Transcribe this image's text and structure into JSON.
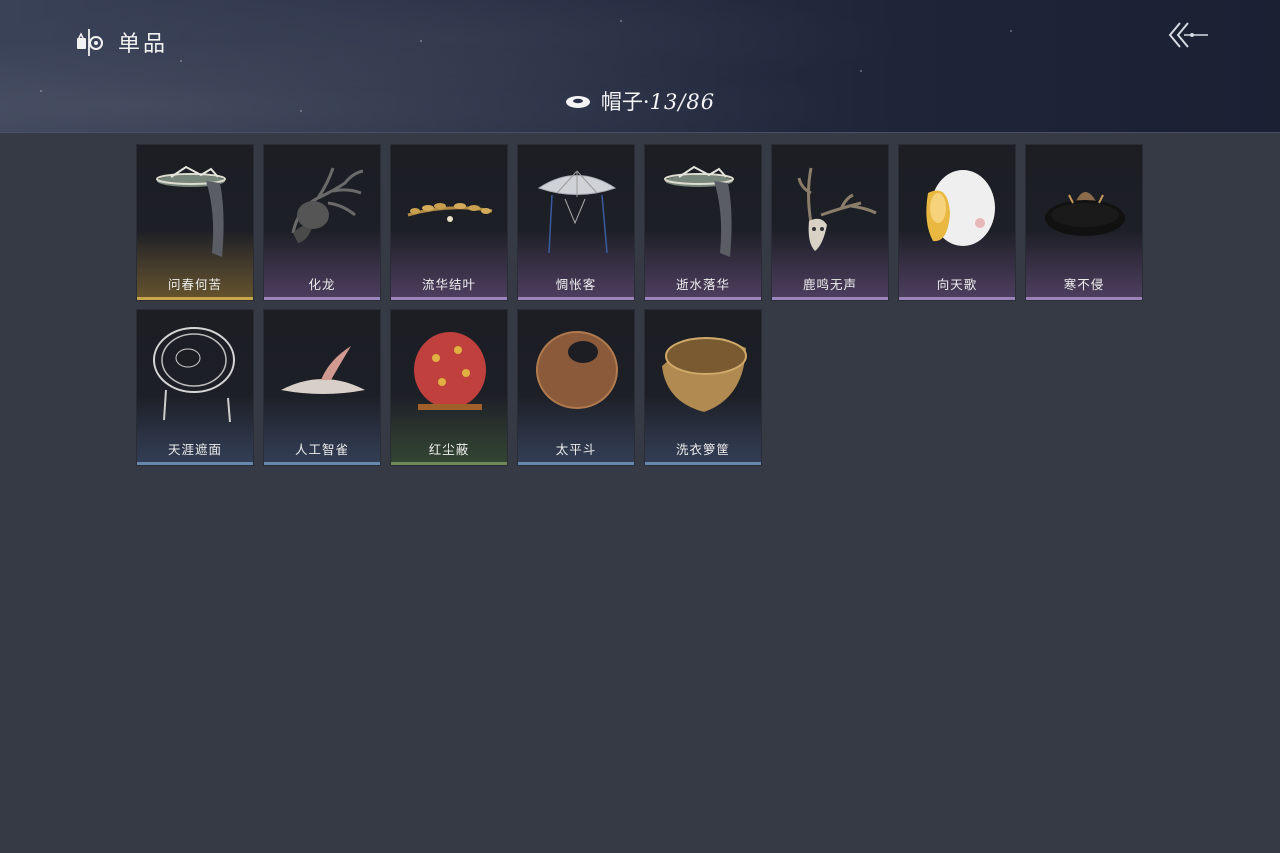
{
  "header": {
    "title": "单品",
    "title_icon": "wardrobe-icon",
    "back_icon": "back-arrow-icon"
  },
  "category": {
    "icon": "hat-icon",
    "label": "帽子·",
    "count": "13/86"
  },
  "rarity_colors": {
    "gold": "#c9a54e",
    "purple": "#9b84bc",
    "blue": "#6788ad",
    "green": "#6f8a5a"
  },
  "items": [
    {
      "name": "问春何苦",
      "rarity": "gold",
      "icon": "veiled-bamboo-hat"
    },
    {
      "name": "化龙",
      "rarity": "purple",
      "icon": "dragon-head"
    },
    {
      "name": "流华结叶",
      "rarity": "purple",
      "icon": "golden-leaf-crown"
    },
    {
      "name": "惆怅客",
      "rarity": "purple",
      "icon": "conical-hat"
    },
    {
      "name": "逝水落华",
      "rarity": "purple",
      "icon": "veiled-bamboo-hat"
    },
    {
      "name": "鹿鸣无声",
      "rarity": "purple",
      "icon": "deer-skull"
    },
    {
      "name": "向天歌",
      "rarity": "purple",
      "icon": "duck-hood"
    },
    {
      "name": "寒不侵",
      "rarity": "purple",
      "icon": "fur-hat"
    },
    {
      "name": "天涯遮面",
      "rarity": "blue",
      "icon": "bamboo-frame-hat"
    },
    {
      "name": "人工智雀",
      "rarity": "blue",
      "icon": "bird-hat"
    },
    {
      "name": "红尘蔽",
      "rarity": "green",
      "icon": "red-hood"
    },
    {
      "name": "太平斗",
      "rarity": "blue",
      "icon": "woven-basket-hat"
    },
    {
      "name": "洗衣箩筐",
      "rarity": "blue",
      "icon": "laundry-basket"
    }
  ]
}
